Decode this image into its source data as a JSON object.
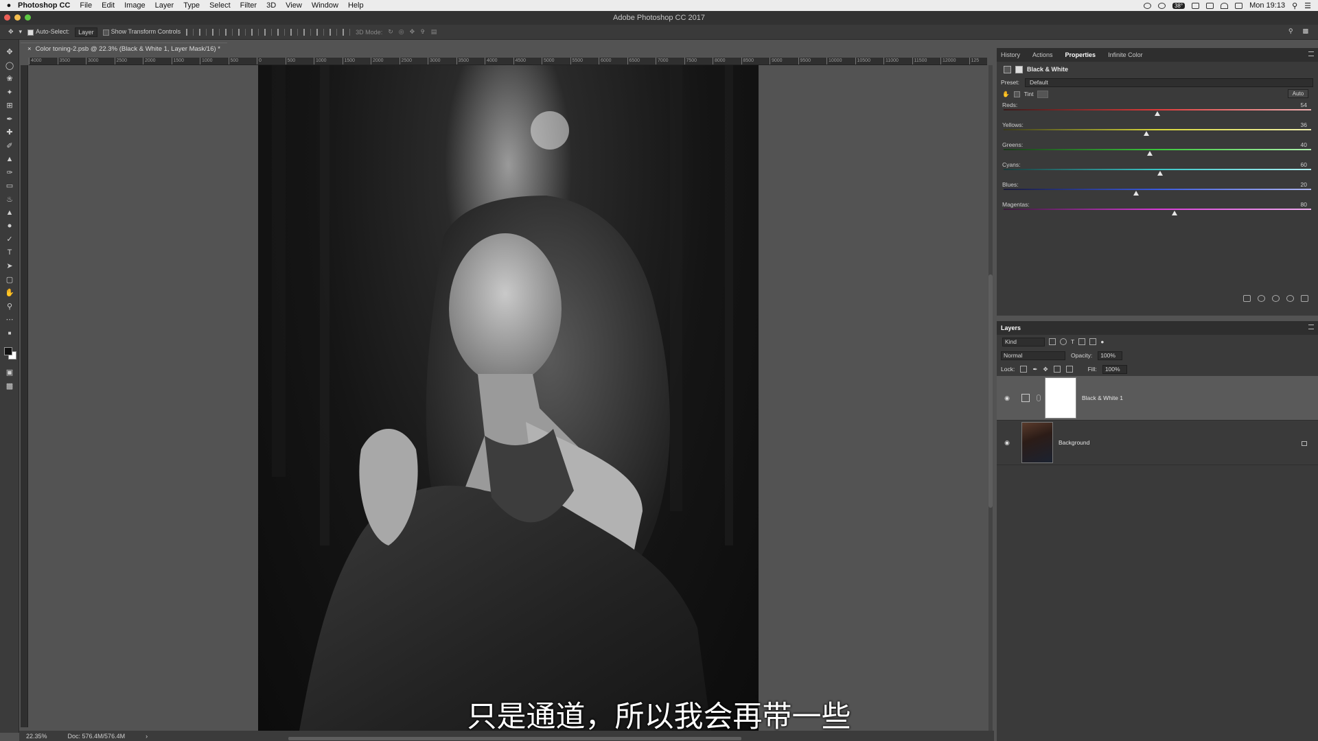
{
  "menubar": {
    "app_name": "Photoshop CC",
    "items": [
      "File",
      "Edit",
      "Image",
      "Layer",
      "Type",
      "Select",
      "Filter",
      "3D",
      "View",
      "Window",
      "Help"
    ],
    "tray_badge": "38°",
    "clock": "Mon 19:13"
  },
  "window": {
    "title": "Adobe Photoshop CC 2017"
  },
  "options_bar": {
    "auto_select_label": "Auto-Select:",
    "auto_select_value": "Layer",
    "transform_label": "Show Transform Controls",
    "mode_label": "3D Mode:"
  },
  "document": {
    "tab_title": "Color toning-2.psb @ 22.3% (Black & White 1, Layer Mask/16) *",
    "zoom": "22.35%",
    "doc_size": "Doc: 576.4M/576.4M",
    "subtitle": "只是通道，所以我会再带一些"
  },
  "ruler": {
    "ticks": [
      "4000",
      "3500",
      "3000",
      "2500",
      "2000",
      "1500",
      "1000",
      "500",
      "0",
      "500",
      "1000",
      "1500",
      "2000",
      "2500",
      "3000",
      "3500",
      "4000",
      "4500",
      "5000",
      "5500",
      "6000",
      "6500",
      "7000",
      "7500",
      "8000",
      "8500",
      "9000",
      "9500",
      "10000",
      "10500",
      "11000",
      "11500",
      "12000",
      "125"
    ]
  },
  "properties_panel": {
    "tabs": [
      "History",
      "Actions",
      "Properties",
      "Infinite Color"
    ],
    "active_tab": "Properties",
    "adjustment_name": "Black & White",
    "preset_label": "Preset:",
    "preset_value": "Default",
    "tint_label": "Tint",
    "auto_label": "Auto",
    "sliders": [
      {
        "label": "Reds:",
        "value": "54",
        "fraction": 0.5,
        "gradient": "linear-gradient(90deg,#3a1a1a,#e03a3a,#f2b2b2)"
      },
      {
        "label": "Yellows:",
        "value": "36",
        "fraction": 0.465,
        "gradient": "linear-gradient(90deg,#3a3a1a,#d8d83a,#f4f4b0)"
      },
      {
        "label": "Greens:",
        "value": "40",
        "fraction": 0.475,
        "gradient": "linear-gradient(90deg,#1a3a1a,#3ac83a,#b0f4b0)"
      },
      {
        "label": "Cyans:",
        "value": "60",
        "fraction": 0.51,
        "gradient": "linear-gradient(90deg,#1a3a3a,#3ac8c8,#b0f4f4)"
      },
      {
        "label": "Blues:",
        "value": "20",
        "fraction": 0.43,
        "gradient": "linear-gradient(90deg,#1a1a3a,#3a5ae0,#b0b8f4)"
      },
      {
        "label": "Magentas:",
        "value": "80",
        "fraction": 0.555,
        "gradient": "linear-gradient(90deg,#3a1a3a,#d83ad8,#f4b0f4)"
      }
    ]
  },
  "layers_panel": {
    "title": "Layers",
    "filter_kind": "Kind",
    "blend_mode": "Normal",
    "opacity_label": "Opacity:",
    "opacity_value": "100%",
    "lock_label": "Lock:",
    "fill_label": "Fill:",
    "fill_value": "100%",
    "layers": [
      {
        "name": "Black & White 1",
        "selected": true
      },
      {
        "name": "Background",
        "selected": false
      }
    ]
  }
}
